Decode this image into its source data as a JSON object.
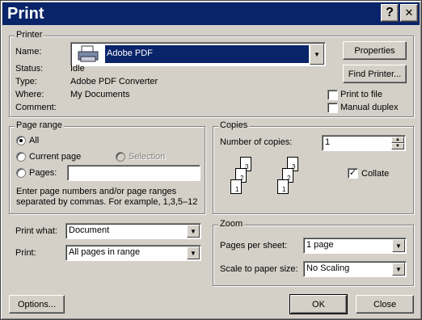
{
  "window": {
    "title": "Print",
    "help_glyph": "?",
    "close_glyph": "✕"
  },
  "printer": {
    "legend": "Printer",
    "name_label": "Name:",
    "name_value": "Adobe PDF",
    "status_label": "Status:",
    "status_value": "Idle",
    "type_label": "Type:",
    "type_value": "Adobe PDF Converter",
    "where_label": "Where:",
    "where_value": "My Documents",
    "comment_label": "Comment:",
    "comment_value": "",
    "properties_label": "Properties",
    "find_printer_label": "Find Printer...",
    "print_to_file_label": "Print to file",
    "print_to_file_checked": false,
    "manual_duplex_label": "Manual duplex",
    "manual_duplex_checked": false,
    "icon": "printer-icon"
  },
  "page_range": {
    "legend": "Page range",
    "all_label": "All",
    "current_page_label": "Current page",
    "selection_label": "Selection",
    "pages_label": "Pages:",
    "pages_value": "",
    "selected": "all",
    "help_line1": "Enter page numbers and/or page ranges",
    "help_line2": "separated by commas.  For example, 1,3,5–12"
  },
  "copies": {
    "legend": "Copies",
    "number_label": "Number of copies:",
    "number_value": "1",
    "collate_label": "Collate",
    "collate_checked": true,
    "collate_check_glyph": "✓",
    "page_numbers": [
      "1",
      "2",
      "3"
    ],
    "icon": "collate-pages-icon"
  },
  "print_what": {
    "label": "Print what:",
    "value": "Document"
  },
  "print": {
    "label": "Print:",
    "value": "All pages in range"
  },
  "zoom": {
    "legend": "Zoom",
    "pages_per_sheet_label": "Pages per sheet:",
    "pages_per_sheet_value": "1 page",
    "scale_label": "Scale to paper size:",
    "scale_value": "No Scaling"
  },
  "footer": {
    "options_label": "Options...",
    "ok_label": "OK",
    "close_label": "Close"
  },
  "glyphs": {
    "dropdown": "▼",
    "spin_up": "▲",
    "spin_down": "▼"
  },
  "colors": {
    "title_bar": "#0a246a",
    "face": "#d4d0c8",
    "selection": "#0a246a"
  }
}
